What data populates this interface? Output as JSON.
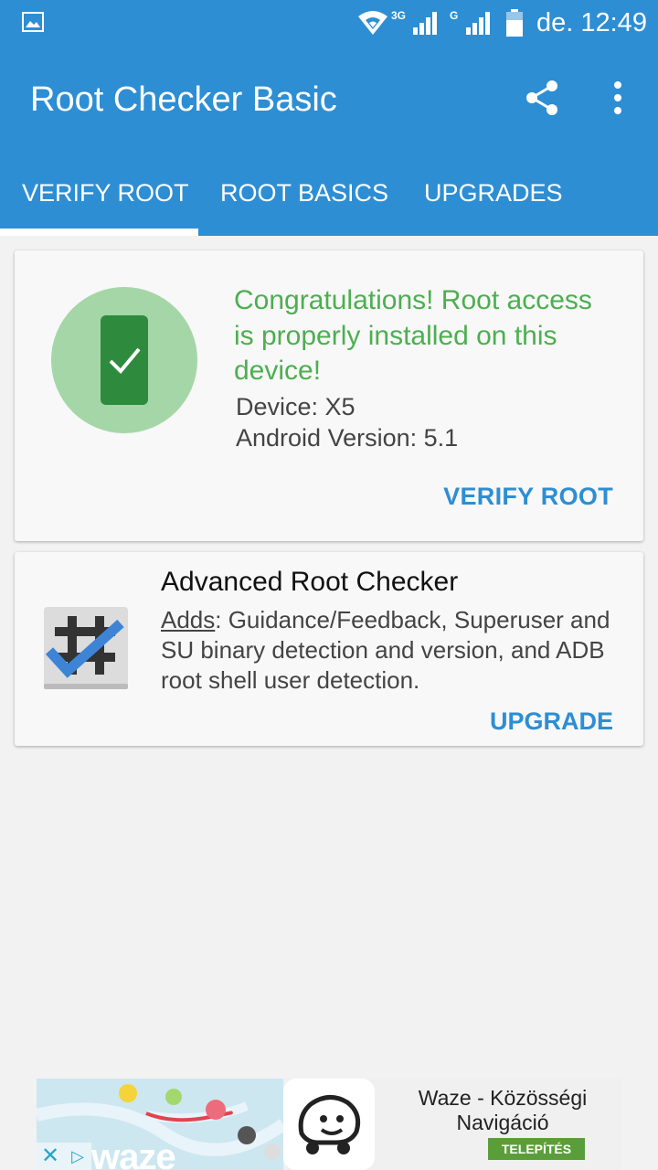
{
  "status": {
    "network_1": "3G",
    "network_2": "G",
    "time": "de. 12:49"
  },
  "appbar": {
    "title": "Root Checker Basic",
    "icons": [
      "share-icon",
      "more-vert-icon"
    ]
  },
  "tabs": [
    {
      "label": "VERIFY ROOT",
      "selected": true
    },
    {
      "label": "ROOT BASICS",
      "selected": false
    },
    {
      "label": "UPGRADES",
      "selected": false
    }
  ],
  "result_card": {
    "message": "Congratulations! Root access is properly installed on this device!",
    "device": "Device: X5",
    "android_version": "Android Version: 5.1",
    "action": "VERIFY ROOT",
    "status_color": "#4caf50"
  },
  "upgrade_card": {
    "title": "Advanced Root Checker",
    "desc_prefix": "Adds",
    "desc": ": Guidance/Feedback, Superuser and SU binary detection and version, and ADB root shell user detection.",
    "action": "UPGRADE"
  },
  "ad": {
    "brand": "waze",
    "title": "Waze - Közösségi Navigáció",
    "cta": "TELEPÍTÉS",
    "close": "✕",
    "adchoices": "▷"
  },
  "colors": {
    "primary": "#2d8ed4",
    "success": "#4caf50",
    "background": "#f2f2f2"
  }
}
